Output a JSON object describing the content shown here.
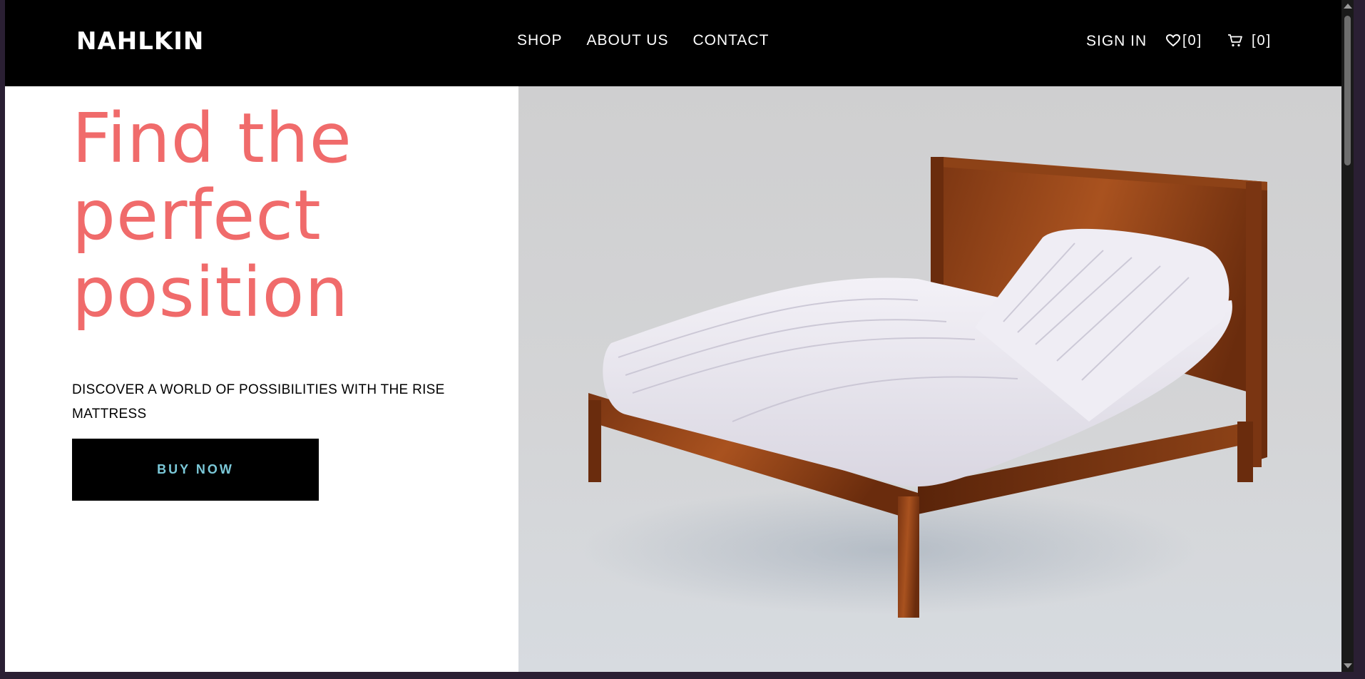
{
  "header": {
    "logo": "NAHLKIN",
    "nav": [
      "SHOP",
      "ABOUT US",
      "CONTACT"
    ],
    "sign_in": "SIGN IN",
    "wishlist_count": "[0]",
    "cart_count": "[0]"
  },
  "hero": {
    "headline": [
      "Find the",
      "perfect",
      "position"
    ],
    "subtitle": "DISCOVER A WORLD OF POSSIBILITIES WITH THE RISE MATTRESS",
    "cta": "BUY NOW",
    "image": "adjustable bed with mattress on wooden frame"
  },
  "colors": {
    "header_bg": "#000000",
    "headline": "#f06b6b",
    "cta_text": "#7bc8d8",
    "image_bg": "#d2d3d5"
  }
}
